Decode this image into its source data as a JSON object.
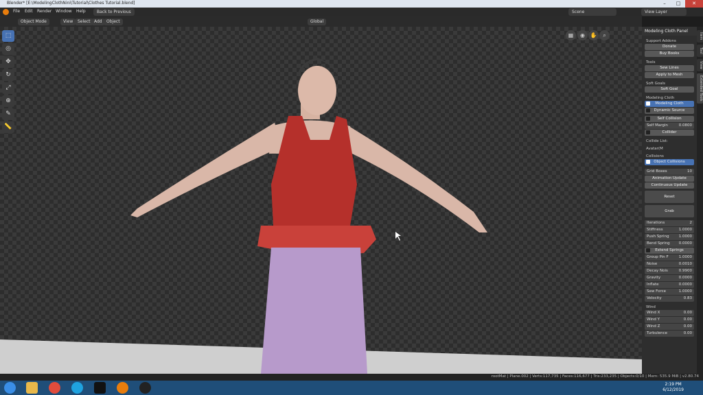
{
  "window": {
    "title": "Blender* [E:\\ModelingClothNini\\Tutorial\\Clothes Tutorial.blend]"
  },
  "menu": {
    "items": [
      "File",
      "Edit",
      "Render",
      "Window",
      "Help"
    ],
    "back_label": "Back to Previous",
    "scene": "Scene",
    "view_layer": "View Layer"
  },
  "viewport_header": {
    "mode": "Object Mode",
    "view": "View",
    "select": "Select",
    "add": "Add",
    "object": "Object",
    "transform": "Global"
  },
  "sidebar": {
    "panel_title": "Modeling Cloth Panel",
    "support_addons": "Support Addons",
    "donate": "Donate",
    "buy_books": "Buy Books",
    "tools": "Tools",
    "sew_lines": "Sew Lines",
    "apply_to_mesh": "Apply to Mesh",
    "soft_goals": "Soft Goals",
    "soft_goal": "Soft Goal",
    "modeling_cloth_h": "Modeling Cloth",
    "modeling_cloth": "Modeling Cloth",
    "dynamic_source": "Dynamic Source",
    "self_collision": "Self Collision",
    "self_margin": "Self Margin",
    "self_margin_v": "0.0800",
    "collider": "Collider",
    "collide_list": "Collide List:",
    "collide_item": "Avatar(M",
    "collisions": "Collisions",
    "object_collisions": "Object Collisions",
    "grid_boxes": "Grid Boxes",
    "grid_boxes_v": "10",
    "animation_update": "Animation Update",
    "continuous_update": "Continuous Update",
    "reset": "Reset",
    "grab": "Grab",
    "iterations": "Iterations",
    "iterations_v": "2",
    "stiffness": "Stiffness",
    "stiffness_v": "1.0000",
    "push_spring": "Push Spring",
    "push_spring_v": "1.0000",
    "bend_spring": "Bend Spring",
    "bend_spring_v": "0.0000",
    "extend_springs": "Extend Springs",
    "group_pin": "Group Pin F",
    "group_pin_v": "1.0000",
    "noise": "Noise",
    "noise_v": "0.0010",
    "decay_noise": "Decay Nois",
    "decay_noise_v": "0.9900",
    "gravity": "Gravity",
    "gravity_v": "0.0000",
    "inflate": "Inflate",
    "inflate_v": "0.0000",
    "sew_force": "Sew Force",
    "sew_force_v": "1.0000",
    "velocity": "Velocity",
    "velocity_v": "0.83",
    "wind": "Wind",
    "wind_x": "Wind X",
    "wind_x_v": "0.00",
    "wind_y": "Wind Y",
    "wind_y_v": "0.00",
    "wind_z": "Wind Z",
    "wind_z_v": "0.00",
    "turbulence": "Turbulence",
    "turbulence_v": "0.00"
  },
  "tabs": [
    "Item",
    "Tool",
    "View",
    "Extended Tools"
  ],
  "status": "rootMat | Plane.002 | Verts:117,735 | Faces:116,677 | Tris:233,235 | Objects:0/10 | Mem: 535.9 MiB | v2.80.74",
  "clock": {
    "time": "2:19 PM",
    "date": "6/12/2019"
  }
}
